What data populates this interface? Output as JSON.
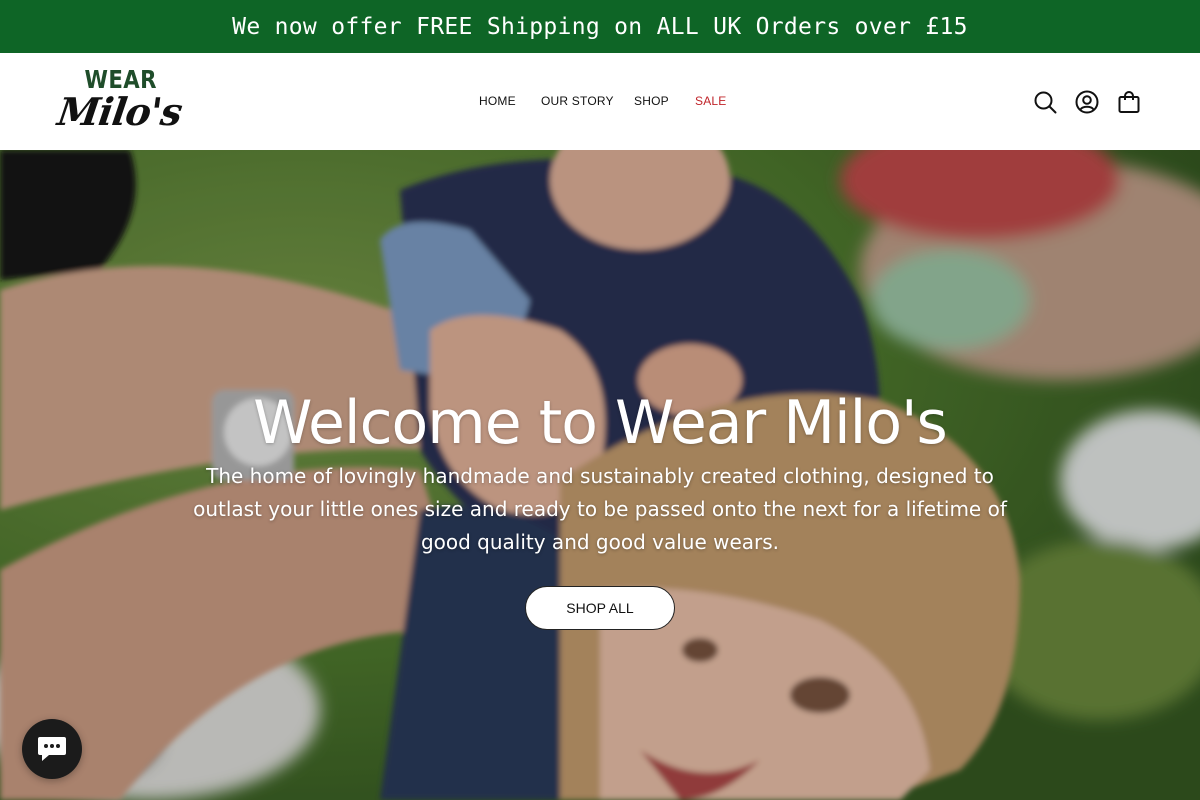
{
  "announcement": {
    "text": "We now offer FREE Shipping on ALL UK Orders over £15"
  },
  "logo": {
    "line1": "WEAR",
    "line2": "Milo's"
  },
  "nav": {
    "home": "HOME",
    "our_story": "OUR STORY",
    "shop": "SHOP",
    "sale": "SALE"
  },
  "header_icons": [
    "search-icon",
    "account-icon",
    "cart-icon"
  ],
  "hero": {
    "title": "Welcome to Wear Milo's",
    "subtitle": "The home of lovingly handmade and sustainably created clothing, designed to outlast your little ones size and ready to be passed onto the next for a lifetime of good quality and good value wears.",
    "button_label": "SHOP ALL"
  },
  "chat": {
    "icon": "chat-icon"
  },
  "colors": {
    "announcement_bg": "#0e6526",
    "sale": "#c0242a",
    "logo_green": "#1f4d2a"
  }
}
